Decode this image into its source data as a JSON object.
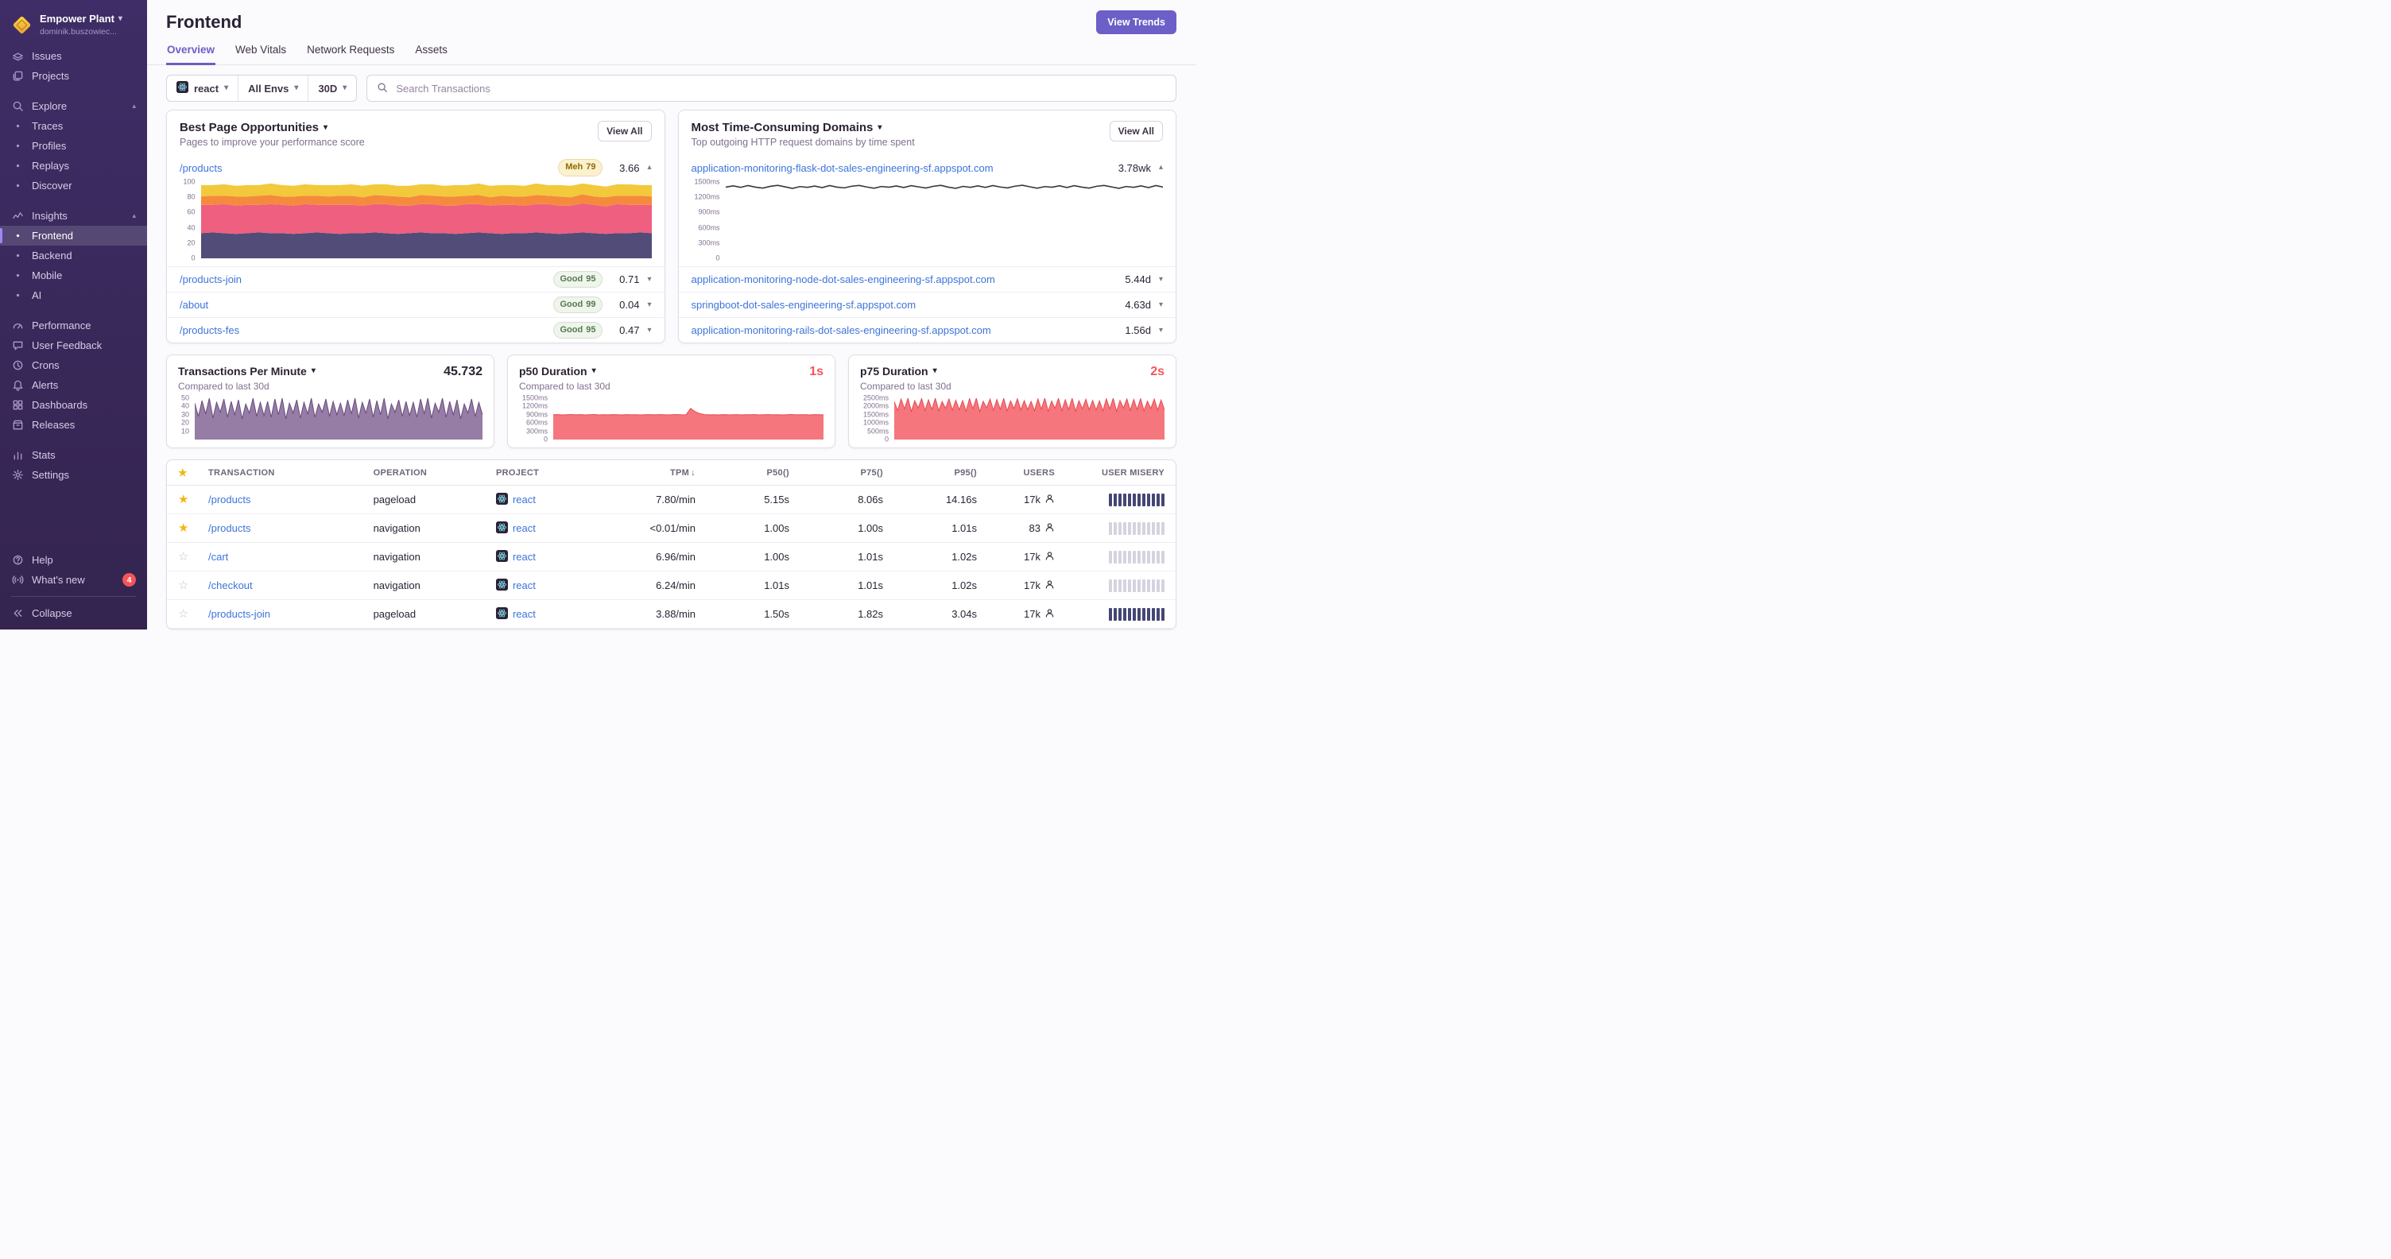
{
  "colors": {
    "accent_purple": "#6C5FC7",
    "link_blue": "#3D74DB",
    "text_dark": "#2B2233",
    "text_gray": "#80708F",
    "danger_red": "#F55459",
    "star_yellow": "#F2B712",
    "misery_high": "#444674",
    "misery_low": "#D6D2DF"
  },
  "sidebar": {
    "org_name": "Empower Plant",
    "org_user": "dominik.buszowiec...",
    "sections": [
      {
        "items": [
          {
            "label": "Issues",
            "icon": "issues"
          },
          {
            "label": "Projects",
            "icon": "projects"
          }
        ]
      },
      {
        "items": [
          {
            "label": "Explore",
            "icon": "search",
            "chevron": "up"
          },
          {
            "label": "Traces",
            "bullet": true
          },
          {
            "label": "Profiles",
            "bullet": true
          },
          {
            "label": "Replays",
            "bullet": true
          },
          {
            "label": "Discover",
            "bullet": true
          }
        ]
      },
      {
        "items": [
          {
            "label": "Insights",
            "icon": "insights",
            "chevron": "up"
          },
          {
            "label": "Frontend",
            "bullet": true,
            "active": true
          },
          {
            "label": "Backend",
            "bullet": true
          },
          {
            "label": "Mobile",
            "bullet": true
          },
          {
            "label": "AI",
            "bullet": true
          }
        ]
      },
      {
        "items": [
          {
            "label": "Performance",
            "icon": "performance"
          },
          {
            "label": "User Feedback",
            "icon": "feedback"
          },
          {
            "label": "Crons",
            "icon": "crons"
          },
          {
            "label": "Alerts",
            "icon": "alerts"
          },
          {
            "label": "Dashboards",
            "icon": "dashboards"
          },
          {
            "label": "Releases",
            "icon": "releases"
          }
        ]
      },
      {
        "items": [
          {
            "label": "Stats",
            "icon": "stats"
          },
          {
            "label": "Settings",
            "icon": "settings"
          }
        ]
      }
    ],
    "footer": [
      {
        "label": "Help",
        "icon": "help"
      },
      {
        "label": "What's new",
        "icon": "broadcast",
        "badge": "4"
      },
      {
        "label": "Collapse",
        "icon": "collapse",
        "divider": true
      }
    ]
  },
  "header": {
    "title": "Frontend",
    "button": "View Trends",
    "tabs": [
      "Overview",
      "Web Vitals",
      "Network Requests",
      "Assets"
    ],
    "active_tab": "Overview"
  },
  "filters": {
    "project": "react",
    "env": "All Envs",
    "date": "30D",
    "search_placeholder": "Search Transactions"
  },
  "opportunities": {
    "title": "Best Page Opportunities",
    "subtitle": "Pages to improve your performance score",
    "view_all": "View All",
    "rows": [
      {
        "path": "/products",
        "badge_label": "Meh",
        "badge_score": "79",
        "score": "3.66",
        "expanded": true
      },
      {
        "path": "/products-join",
        "badge_label": "Good",
        "badge_score": "95",
        "score": "0.71",
        "expanded": false
      },
      {
        "path": "/about",
        "badge_label": "Good",
        "badge_score": "99",
        "score": "0.04",
        "expanded": false
      },
      {
        "path": "/products-fes",
        "badge_label": "Good",
        "badge_score": "95",
        "score": "0.47",
        "expanded": false
      }
    ]
  },
  "domains": {
    "title": "Most Time-Consuming Domains",
    "subtitle": "Top outgoing HTTP request domains by time spent",
    "view_all": "View All",
    "rows": [
      {
        "domain": "application-monitoring-flask-dot-sales-engineering-sf.appspot.com",
        "value": "3.78wk",
        "expanded": true
      },
      {
        "domain": "application-monitoring-node-dot-sales-engineering-sf.appspot.com",
        "value": "5.44d",
        "expanded": false
      },
      {
        "domain": "springboot-dot-sales-engineering-sf.appspot.com",
        "value": "4.63d",
        "expanded": false
      },
      {
        "domain": "application-monitoring-rails-dot-sales-engineering-sf.appspot.com",
        "value": "1.56d",
        "expanded": false
      }
    ]
  },
  "metrics": [
    {
      "title": "Transactions Per Minute",
      "subtitle": "Compared to last 30d",
      "value": "45.732",
      "value_color": "#2B2233",
      "chart": "tpm"
    },
    {
      "title": "p50 Duration",
      "subtitle": "Compared to last 30d",
      "value": "1s",
      "value_color": "#F55459",
      "chart": "p50"
    },
    {
      "title": "p75 Duration",
      "subtitle": "Compared to last 30d",
      "value": "2s",
      "value_color": "#F55459",
      "chart": "p75"
    }
  ],
  "table": {
    "columns": [
      {
        "label": "",
        "key": "star"
      },
      {
        "label": "TRANSACTION",
        "key": "transaction"
      },
      {
        "label": "OPERATION",
        "key": "operation"
      },
      {
        "label": "PROJECT",
        "key": "project"
      },
      {
        "label": "TPM",
        "key": "tpm",
        "sort": "desc",
        "align": "right"
      },
      {
        "label": "P50()",
        "key": "p50",
        "align": "right"
      },
      {
        "label": "P75()",
        "key": "p75",
        "align": "right"
      },
      {
        "label": "P95()",
        "key": "p95",
        "align": "right"
      },
      {
        "label": "USERS",
        "key": "users",
        "align": "right"
      },
      {
        "label": "USER MISERY",
        "key": "misery",
        "align": "right"
      }
    ],
    "rows": [
      {
        "starred": true,
        "transaction": "/products",
        "operation": "pageload",
        "project": "react",
        "tpm": "7.80/min",
        "p50": "5.15s",
        "p75": "8.06s",
        "p95": "14.16s",
        "users": "17k",
        "misery": "high"
      },
      {
        "starred": true,
        "transaction": "/products",
        "operation": "navigation",
        "project": "react",
        "tpm": "<0.01/min",
        "p50": "1.00s",
        "p75": "1.00s",
        "p95": "1.01s",
        "users": "83",
        "misery": "low"
      },
      {
        "starred": false,
        "transaction": "/cart",
        "operation": "navigation",
        "project": "react",
        "tpm": "6.96/min",
        "p50": "1.00s",
        "p75": "1.01s",
        "p95": "1.02s",
        "users": "17k",
        "misery": "low"
      },
      {
        "starred": false,
        "transaction": "/checkout",
        "operation": "navigation",
        "project": "react",
        "tpm": "6.24/min",
        "p50": "1.01s",
        "p75": "1.01s",
        "p95": "1.02s",
        "users": "17k",
        "misery": "low"
      },
      {
        "starred": false,
        "transaction": "/products-join",
        "operation": "pageload",
        "project": "react",
        "tpm": "3.88/min",
        "p50": "1.50s",
        "p75": "1.82s",
        "p95": "3.04s",
        "users": "17k",
        "misery": "high"
      }
    ]
  },
  "chart_data": [
    {
      "id": "opportunity-stack",
      "type": "area",
      "stacked": true,
      "title": "/products performance score breakdown (stacked)",
      "xlabel": "",
      "ylabel": "score",
      "ymax": 100,
      "yticks": [
        [
          100,
          "100"
        ],
        [
          80,
          "80"
        ],
        [
          60,
          "60"
        ],
        [
          40,
          "40"
        ],
        [
          20,
          "20"
        ],
        [
          0,
          "0"
        ]
      ],
      "series": [
        {
          "name": "layer-indigo",
          "color": "#524C78",
          "values": [
            33,
            34,
            33,
            32,
            33,
            34,
            33,
            33,
            32,
            33,
            34,
            33,
            32,
            33,
            33,
            34,
            33,
            32,
            33,
            34,
            33,
            33,
            32,
            33,
            34,
            33,
            32,
            33,
            33,
            34,
            33,
            32,
            33,
            34,
            33,
            32,
            33,
            33,
            34,
            33
          ]
        },
        {
          "name": "layer-rose",
          "color": "#EF5F7F",
          "values": [
            37,
            36,
            38,
            37,
            37,
            36,
            38,
            37,
            37,
            38,
            36,
            37,
            38,
            37,
            36,
            37,
            38,
            37,
            36,
            37,
            38,
            36,
            37,
            38,
            37,
            36,
            38,
            37,
            36,
            37,
            38,
            37,
            36,
            38,
            37,
            36,
            38,
            37,
            36,
            37
          ]
        },
        {
          "name": "layer-orange",
          "color": "#F58A3D",
          "values": [
            11,
            12,
            11,
            12,
            11,
            12,
            12,
            11,
            12,
            11,
            12,
            11,
            12,
            12,
            11,
            12,
            11,
            12,
            11,
            12,
            11,
            12,
            12,
            11,
            12,
            11,
            12,
            11,
            12,
            12,
            11,
            12,
            11,
            12,
            11,
            12,
            11,
            12,
            12,
            11
          ]
        },
        {
          "name": "layer-yellow",
          "color": "#F2C93B",
          "values": [
            15,
            14,
            15,
            14,
            15,
            14,
            15,
            15,
            14,
            15,
            14,
            15,
            14,
            15,
            15,
            14,
            15,
            14,
            15,
            14,
            15,
            14,
            15,
            14,
            15,
            15,
            14,
            15,
            14,
            15,
            14,
            15,
            15,
            14,
            15,
            14,
            15,
            15,
            14,
            15
          ]
        }
      ]
    },
    {
      "id": "domain-flask",
      "type": "line",
      "title": "application-monitoring-flask time spent (ms)",
      "xlabel": "",
      "ylabel": "ms",
      "ymax": 1500,
      "color": "#3A3540",
      "yticks": [
        [
          1500,
          "1500ms"
        ],
        [
          1200,
          "1200ms"
        ],
        [
          900,
          "900ms"
        ],
        [
          600,
          "600ms"
        ],
        [
          300,
          "300ms"
        ],
        [
          0,
          "0"
        ]
      ],
      "values": [
        1400,
        1425,
        1395,
        1430,
        1400,
        1380,
        1415,
        1435,
        1405,
        1375,
        1410,
        1395,
        1420,
        1390,
        1430,
        1400,
        1385,
        1418,
        1432,
        1402,
        1378,
        1412,
        1398,
        1422,
        1392,
        1428,
        1404,
        1382,
        1416,
        1434,
        1400,
        1376,
        1414,
        1396,
        1424,
        1394,
        1430,
        1402,
        1384,
        1418,
        1436,
        1406,
        1378,
        1410,
        1398,
        1426,
        1392,
        1428,
        1400,
        1380,
        1416,
        1432,
        1404,
        1376,
        1412,
        1396,
        1424,
        1390,
        1430,
        1400
      ]
    },
    {
      "id": "tpm",
      "type": "area",
      "title": "Transactions Per Minute (30d)",
      "xlabel": "",
      "ylabel": "tpm",
      "ymax": 50,
      "color": "#7A5C8F",
      "stroke": "#6A4A7D",
      "yticks": [
        [
          50,
          "50"
        ],
        [
          40,
          "40"
        ],
        [
          30,
          "30"
        ],
        [
          20,
          "20"
        ],
        [
          10,
          "10"
        ]
      ],
      "values": [
        44,
        28,
        47,
        31,
        50,
        26,
        45,
        33,
        49,
        27,
        46,
        30,
        48,
        25,
        43,
        32,
        50,
        28,
        45,
        29,
        46,
        27,
        49,
        30,
        50,
        25,
        44,
        32,
        48,
        26,
        45,
        31,
        50,
        27,
        43,
        33,
        49,
        28,
        46,
        30,
        44,
        29,
        48,
        31,
        50,
        26,
        45,
        32,
        49,
        27,
        47,
        30,
        50,
        25,
        43,
        33,
        48,
        28,
        46,
        29,
        45,
        27,
        49,
        31,
        50,
        26,
        44,
        33,
        50,
        27,
        46,
        30,
        48,
        25,
        43,
        32,
        49,
        28,
        45,
        30
      ]
    },
    {
      "id": "p50",
      "type": "area",
      "title": "p50 Duration (30d, ms)",
      "xlabel": "",
      "ylabel": "ms",
      "ymax": 1500,
      "color": "#F2545B",
      "stroke": "#E84A52",
      "yticks": [
        [
          1500,
          "1500ms"
        ],
        [
          1200,
          "1200ms"
        ],
        [
          900,
          "900ms"
        ],
        [
          600,
          "600ms"
        ],
        [
          300,
          "300ms"
        ],
        [
          0,
          "0"
        ]
      ],
      "values": [
        900,
        906,
        896,
        902,
        910,
        898,
        904,
        894,
        900,
        908,
        896,
        902,
        898,
        906,
        900,
        894,
        904,
        898,
        902,
        896,
        900,
        906,
        898,
        904,
        900,
        896,
        902,
        908,
        898,
        900,
        1130,
        1010,
        940,
        904,
        898,
        902,
        896,
        906,
        900,
        898,
        904,
        896,
        902,
        900,
        906,
        894,
        900,
        904,
        898,
        902,
        896,
        900,
        908,
        898,
        902,
        900,
        896,
        904,
        900,
        898
      ]
    },
    {
      "id": "p75",
      "type": "area",
      "title": "p75 Duration (30d, ms)",
      "xlabel": "",
      "ylabel": "ms",
      "ymax": 2500,
      "color": "#F2545B",
      "stroke": "#E84A52",
      "yticks": [
        [
          2500,
          "2500ms"
        ],
        [
          2000,
          "2000ms"
        ],
        [
          1500,
          "1500ms"
        ],
        [
          1000,
          "1000ms"
        ],
        [
          500,
          "500ms"
        ],
        [
          0,
          "0"
        ]
      ],
      "values": [
        2300,
        1750,
        2450,
        1850,
        2500,
        1700,
        2350,
        1900,
        2480,
        1760,
        2400,
        1820,
        2500,
        1740,
        2300,
        1880,
        2460,
        1780,
        2380,
        1800,
        2350,
        1720,
        2480,
        1860,
        2500,
        1690,
        2320,
        1910,
        2450,
        1770,
        2420,
        1830,
        2490,
        1730,
        2340,
        1870,
        2470,
        1790,
        2360,
        1810,
        2310,
        1740,
        2460,
        1840,
        2500,
        1710,
        2330,
        1890,
        2490,
        1750,
        2410,
        1810,
        2500,
        1720,
        2350,
        1860,
        2440,
        1800,
        2370,
        1790,
        2340,
        1730,
        2470,
        1850,
        2500,
        1700,
        2360,
        1900,
        2460,
        1760,
        2430,
        1820,
        2480,
        1740,
        2320,
        1880,
        2450,
        1780,
        2390,
        1800
      ]
    }
  ]
}
